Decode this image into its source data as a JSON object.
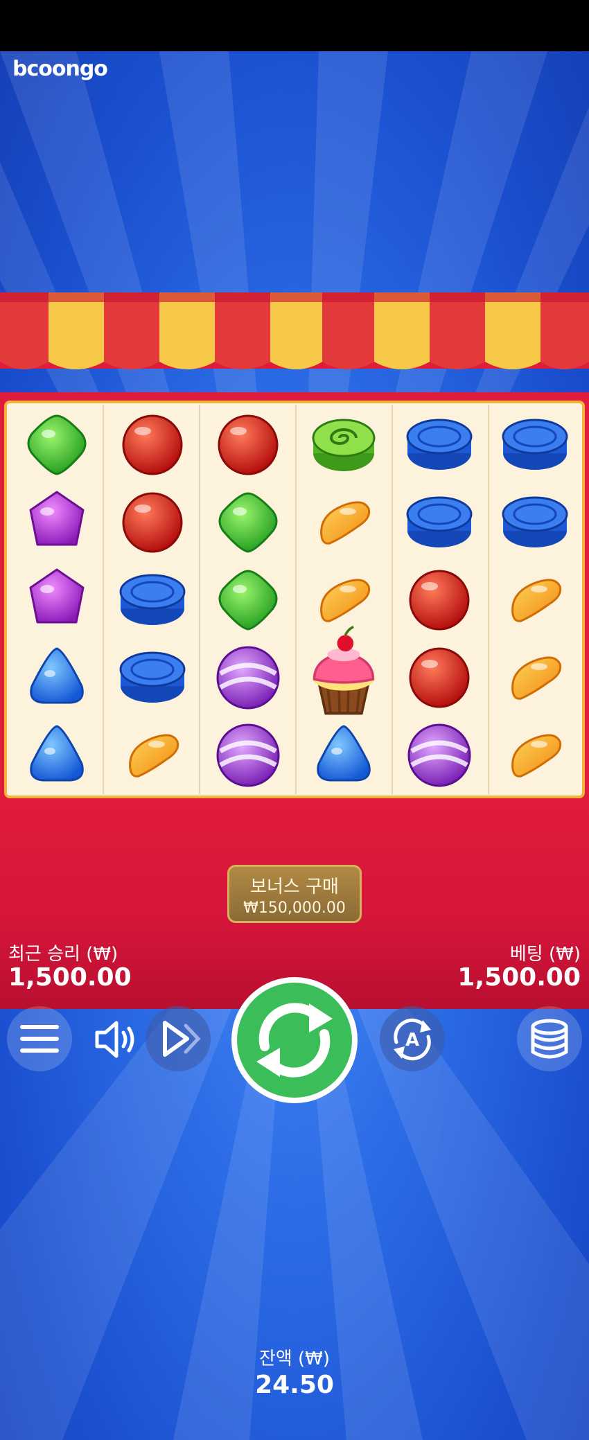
{
  "brand": {
    "logo_text": "bcoongo"
  },
  "reels": {
    "columns": [
      [
        "green-gummy",
        "purple-gummy",
        "purple-gummy",
        "blue-gummy",
        "blue-gummy"
      ],
      [
        "red-ball",
        "red-ball",
        "blue-wafer",
        "blue-wafer",
        "orange-jelly"
      ],
      [
        "red-ball",
        "green-gummy",
        "green-gummy",
        "purple-lollipop",
        "purple-lollipop"
      ],
      [
        "green-swirl",
        "orange-jelly",
        "orange-jelly",
        "cupcake",
        "blue-gummy"
      ],
      [
        "blue-wafer",
        "blue-wafer",
        "red-ball",
        "red-ball",
        "purple-lollipop"
      ],
      [
        "blue-wafer",
        "blue-wafer",
        "orange-jelly",
        "orange-jelly",
        "orange-jelly"
      ]
    ]
  },
  "bonus_buy": {
    "title": "보너스 구매",
    "price": "₩150,000.00"
  },
  "last_win": {
    "label": "최근 승리 (₩)",
    "value": "1,500.00"
  },
  "bet": {
    "label": "베팅 (₩)",
    "value": "1,500.00"
  },
  "controls": {
    "menu": "menu-icon",
    "sound": "speaker-icon",
    "turbo": "play-fast-icon",
    "spin": "spin-icon",
    "autoplay": "autoplay-icon",
    "bet_settings": "coins-icon"
  },
  "balance": {
    "label": "잔액 (₩)",
    "value": "24.50"
  },
  "colors": {
    "sky": "#2d6ee8",
    "frame": "#e01c3c",
    "spin": "#3bbd5a",
    "awning_yellow": "#f7c948"
  }
}
